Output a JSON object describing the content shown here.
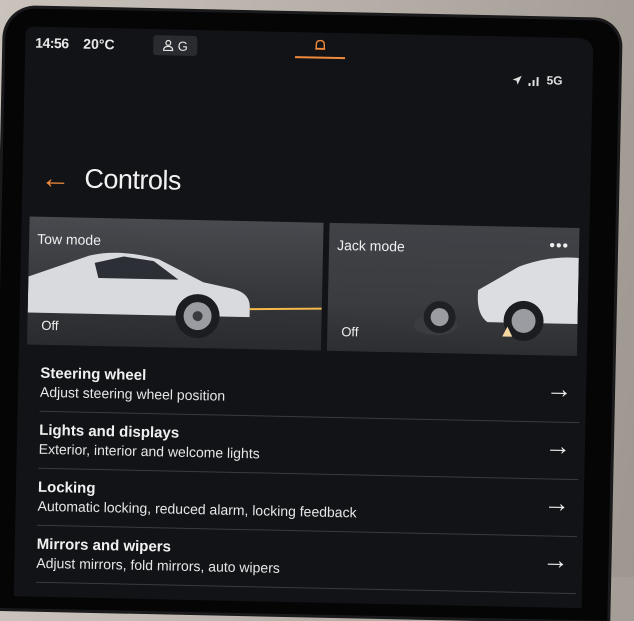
{
  "status_bar": {
    "time": "14:56",
    "temperature": "20°C",
    "profile_letter": "G",
    "network": "5G"
  },
  "header": {
    "title": "Controls"
  },
  "cards": [
    {
      "label": "Tow mode",
      "state": "Off"
    },
    {
      "label": "Jack mode",
      "state": "Off",
      "more": "•••"
    }
  ],
  "list": [
    {
      "title": "Steering wheel",
      "subtitle": "Adjust steering wheel position"
    },
    {
      "title": "Lights and displays",
      "subtitle": "Exterior, interior and welcome lights"
    },
    {
      "title": "Locking",
      "subtitle": "Automatic locking, reduced alarm, locking feedback"
    },
    {
      "title": "Mirrors and wipers",
      "subtitle": "Adjust mirrors, fold mirrors, auto wipers"
    }
  ],
  "icons": {
    "back": "back-arrow-icon",
    "row_arrow": "right-arrow-icon",
    "notification": "bell-icon",
    "location": "location-icon",
    "signal": "signal-icon",
    "profile": "profile-icon"
  },
  "colors": {
    "accent": "#f08b3c",
    "background": "#121316",
    "text": "#f0f0f0"
  }
}
